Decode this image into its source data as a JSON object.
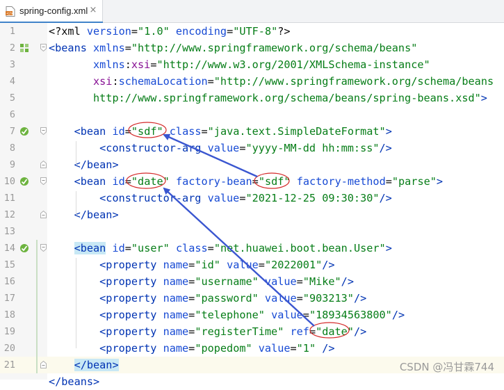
{
  "tab": {
    "filename": "spring-config.xml",
    "close_glyph": "×",
    "icon": "xml-file-icon"
  },
  "editor": {
    "line_numbers": [
      "1",
      "2",
      "3",
      "4",
      "5",
      "6",
      "7",
      "8",
      "9",
      "10",
      "11",
      "12",
      "13",
      "14",
      "15",
      "16",
      "17",
      "18",
      "19",
      "20",
      "21"
    ],
    "current_line": "21",
    "gutter_icons": {
      "bean_marker": "spring-bean-icon",
      "beans_marker": "spring-beans-icon"
    },
    "code_lines": [
      [
        {
          "t": "<?xml ",
          "c": "t-prolog"
        },
        {
          "t": "version",
          "c": "t-attr"
        },
        {
          "t": "=",
          "c": "t-plain"
        },
        {
          "t": "\"1.0\"",
          "c": "t-val"
        },
        {
          "t": " ",
          "c": "t-plain"
        },
        {
          "t": "encoding",
          "c": "t-attr"
        },
        {
          "t": "=",
          "c": "t-plain"
        },
        {
          "t": "\"UTF-8\"",
          "c": "t-val"
        },
        {
          "t": "?>",
          "c": "t-prolog"
        }
      ],
      [
        {
          "t": "<beans ",
          "c": "t-tag"
        },
        {
          "t": "xmlns",
          "c": "t-attr"
        },
        {
          "t": "=",
          "c": "t-plain"
        },
        {
          "t": "\"http://www.springframework.org/schema/beans\"",
          "c": "t-val"
        }
      ],
      [
        {
          "t": "       ",
          "c": "t-plain"
        },
        {
          "t": "xmlns",
          "c": "t-attr"
        },
        {
          "t": ":",
          "c": "t-plain"
        },
        {
          "t": "xsi",
          "c": "t-ns"
        },
        {
          "t": "=",
          "c": "t-plain"
        },
        {
          "t": "\"http://www.w3.org/2001/XMLSchema-instance\"",
          "c": "t-val"
        }
      ],
      [
        {
          "t": "       ",
          "c": "t-plain"
        },
        {
          "t": "xsi",
          "c": "t-ns"
        },
        {
          "t": ":",
          "c": "t-plain"
        },
        {
          "t": "schemaLocation",
          "c": "t-attr"
        },
        {
          "t": "=",
          "c": "t-plain"
        },
        {
          "t": "\"http://www.springframework.org/schema/beans",
          "c": "t-val"
        }
      ],
      [
        {
          "t": "       ",
          "c": "t-plain"
        },
        {
          "t": "http://www.springframework.org/schema/beans/spring-beans.xsd\"",
          "c": "t-val"
        },
        {
          "t": ">",
          "c": "t-tag"
        }
      ],
      [],
      [
        {
          "t": "    ",
          "c": "t-plain"
        },
        {
          "t": "<bean ",
          "c": "t-tag"
        },
        {
          "t": "id",
          "c": "t-attr"
        },
        {
          "t": "=",
          "c": "t-plain"
        },
        {
          "t": "\"sdf\"",
          "c": "t-val"
        },
        {
          "t": " ",
          "c": "t-plain"
        },
        {
          "t": "class",
          "c": "t-attr"
        },
        {
          "t": "=",
          "c": "t-plain"
        },
        {
          "t": "\"java.text.SimpleDateFormat\"",
          "c": "t-val"
        },
        {
          "t": ">",
          "c": "t-tag"
        }
      ],
      [
        {
          "t": "        ",
          "c": "t-plain"
        },
        {
          "t": "<constructor-arg ",
          "c": "t-tag"
        },
        {
          "t": "value",
          "c": "t-attr"
        },
        {
          "t": "=",
          "c": "t-plain"
        },
        {
          "t": "\"yyyy-MM-dd hh:mm:ss\"",
          "c": "t-val"
        },
        {
          "t": "/>",
          "c": "t-tag"
        }
      ],
      [
        {
          "t": "    ",
          "c": "t-plain"
        },
        {
          "t": "</bean>",
          "c": "t-tag"
        }
      ],
      [
        {
          "t": "    ",
          "c": "t-plain"
        },
        {
          "t": "<bean ",
          "c": "t-tag"
        },
        {
          "t": "id",
          "c": "t-attr"
        },
        {
          "t": "=",
          "c": "t-plain"
        },
        {
          "t": "\"date\"",
          "c": "t-val"
        },
        {
          "t": " ",
          "c": "t-plain"
        },
        {
          "t": "factory-bean",
          "c": "t-attr"
        },
        {
          "t": "=",
          "c": "t-plain"
        },
        {
          "t": "\"sdf\"",
          "c": "t-val"
        },
        {
          "t": " ",
          "c": "t-plain"
        },
        {
          "t": "factory-method",
          "c": "t-attr"
        },
        {
          "t": "=",
          "c": "t-plain"
        },
        {
          "t": "\"parse\"",
          "c": "t-val"
        },
        {
          "t": ">",
          "c": "t-tag"
        }
      ],
      [
        {
          "t": "        ",
          "c": "t-plain"
        },
        {
          "t": "<constructor-arg ",
          "c": "t-tag"
        },
        {
          "t": "value",
          "c": "t-attr"
        },
        {
          "t": "=",
          "c": "t-plain"
        },
        {
          "t": "\"2021-12-25 09:30:30\"",
          "c": "t-val"
        },
        {
          "t": "/>",
          "c": "t-tag"
        }
      ],
      [
        {
          "t": "    ",
          "c": "t-plain"
        },
        {
          "t": "</bean>",
          "c": "t-tag"
        }
      ],
      [],
      [
        {
          "t": "    ",
          "c": "t-plain"
        },
        {
          "t": "<bean",
          "c": "t-tag t-hl"
        },
        {
          "t": " ",
          "c": "t-tag"
        },
        {
          "t": "id",
          "c": "t-attr"
        },
        {
          "t": "=",
          "c": "t-plain"
        },
        {
          "t": "\"user\"",
          "c": "t-val"
        },
        {
          "t": " ",
          "c": "t-plain"
        },
        {
          "t": "class",
          "c": "t-attr"
        },
        {
          "t": "=",
          "c": "t-plain"
        },
        {
          "t": "\"net.huawei.boot.bean.User\"",
          "c": "t-val"
        },
        {
          "t": ">",
          "c": "t-tag"
        }
      ],
      [
        {
          "t": "        ",
          "c": "t-plain"
        },
        {
          "t": "<property ",
          "c": "t-tag"
        },
        {
          "t": "name",
          "c": "t-attr"
        },
        {
          "t": "=",
          "c": "t-plain"
        },
        {
          "t": "\"id\"",
          "c": "t-val"
        },
        {
          "t": " ",
          "c": "t-plain"
        },
        {
          "t": "value",
          "c": "t-attr"
        },
        {
          "t": "=",
          "c": "t-plain"
        },
        {
          "t": "\"2022001\"",
          "c": "t-val"
        },
        {
          "t": "/>",
          "c": "t-tag"
        }
      ],
      [
        {
          "t": "        ",
          "c": "t-plain"
        },
        {
          "t": "<property ",
          "c": "t-tag"
        },
        {
          "t": "name",
          "c": "t-attr"
        },
        {
          "t": "=",
          "c": "t-plain"
        },
        {
          "t": "\"username\"",
          "c": "t-val"
        },
        {
          "t": " ",
          "c": "t-plain"
        },
        {
          "t": "value",
          "c": "t-attr"
        },
        {
          "t": "=",
          "c": "t-plain"
        },
        {
          "t": "\"Mike\"",
          "c": "t-val"
        },
        {
          "t": "/>",
          "c": "t-tag"
        }
      ],
      [
        {
          "t": "        ",
          "c": "t-plain"
        },
        {
          "t": "<property ",
          "c": "t-tag"
        },
        {
          "t": "name",
          "c": "t-attr"
        },
        {
          "t": "=",
          "c": "t-plain"
        },
        {
          "t": "\"password\"",
          "c": "t-val"
        },
        {
          "t": " ",
          "c": "t-plain"
        },
        {
          "t": "value",
          "c": "t-attr"
        },
        {
          "t": "=",
          "c": "t-plain"
        },
        {
          "t": "\"903213\"",
          "c": "t-val"
        },
        {
          "t": "/>",
          "c": "t-tag"
        }
      ],
      [
        {
          "t": "        ",
          "c": "t-plain"
        },
        {
          "t": "<property ",
          "c": "t-tag"
        },
        {
          "t": "name",
          "c": "t-attr"
        },
        {
          "t": "=",
          "c": "t-plain"
        },
        {
          "t": "\"telephone\"",
          "c": "t-val"
        },
        {
          "t": " ",
          "c": "t-plain"
        },
        {
          "t": "value",
          "c": "t-attr"
        },
        {
          "t": "=",
          "c": "t-plain"
        },
        {
          "t": "\"18934563800\"",
          "c": "t-val"
        },
        {
          "t": "/>",
          "c": "t-tag"
        }
      ],
      [
        {
          "t": "        ",
          "c": "t-plain"
        },
        {
          "t": "<property ",
          "c": "t-tag"
        },
        {
          "t": "name",
          "c": "t-attr"
        },
        {
          "t": "=",
          "c": "t-plain"
        },
        {
          "t": "\"registerTime\"",
          "c": "t-val"
        },
        {
          "t": " ",
          "c": "t-plain"
        },
        {
          "t": "ref",
          "c": "t-attr"
        },
        {
          "t": "=",
          "c": "t-plain"
        },
        {
          "t": "\"date\"",
          "c": "t-val"
        },
        {
          "t": "/>",
          "c": "t-tag"
        }
      ],
      [
        {
          "t": "        ",
          "c": "t-plain"
        },
        {
          "t": "<property ",
          "c": "t-tag"
        },
        {
          "t": "name",
          "c": "t-attr"
        },
        {
          "t": "=",
          "c": "t-plain"
        },
        {
          "t": "\"popedom\"",
          "c": "t-val"
        },
        {
          "t": " ",
          "c": "t-plain"
        },
        {
          "t": "value",
          "c": "t-attr"
        },
        {
          "t": "=",
          "c": "t-plain"
        },
        {
          "t": "\"1\"",
          "c": "t-val"
        },
        {
          "t": " ",
          "c": "t-plain"
        },
        {
          "t": "/>",
          "c": "t-tag"
        }
      ],
      [
        {
          "t": "    ",
          "c": "t-plain"
        },
        {
          "t": "</bean>",
          "c": "t-tag t-hl"
        }
      ]
    ],
    "partial_last_line": "</beans>"
  },
  "annotations": {
    "color_ellipse": "#d42a2a",
    "color_arrow": "#3a56d0"
  },
  "watermark": "CSDN @冯甘霖744",
  "colors": {
    "tag": "#0033b3",
    "attribute": "#174ad4",
    "namespace": "#871094",
    "string": "#067d17",
    "gutter_bg": "#f6f6f6",
    "current_line_bg": "#fcfaed",
    "tab_accent": "#4083c9"
  }
}
